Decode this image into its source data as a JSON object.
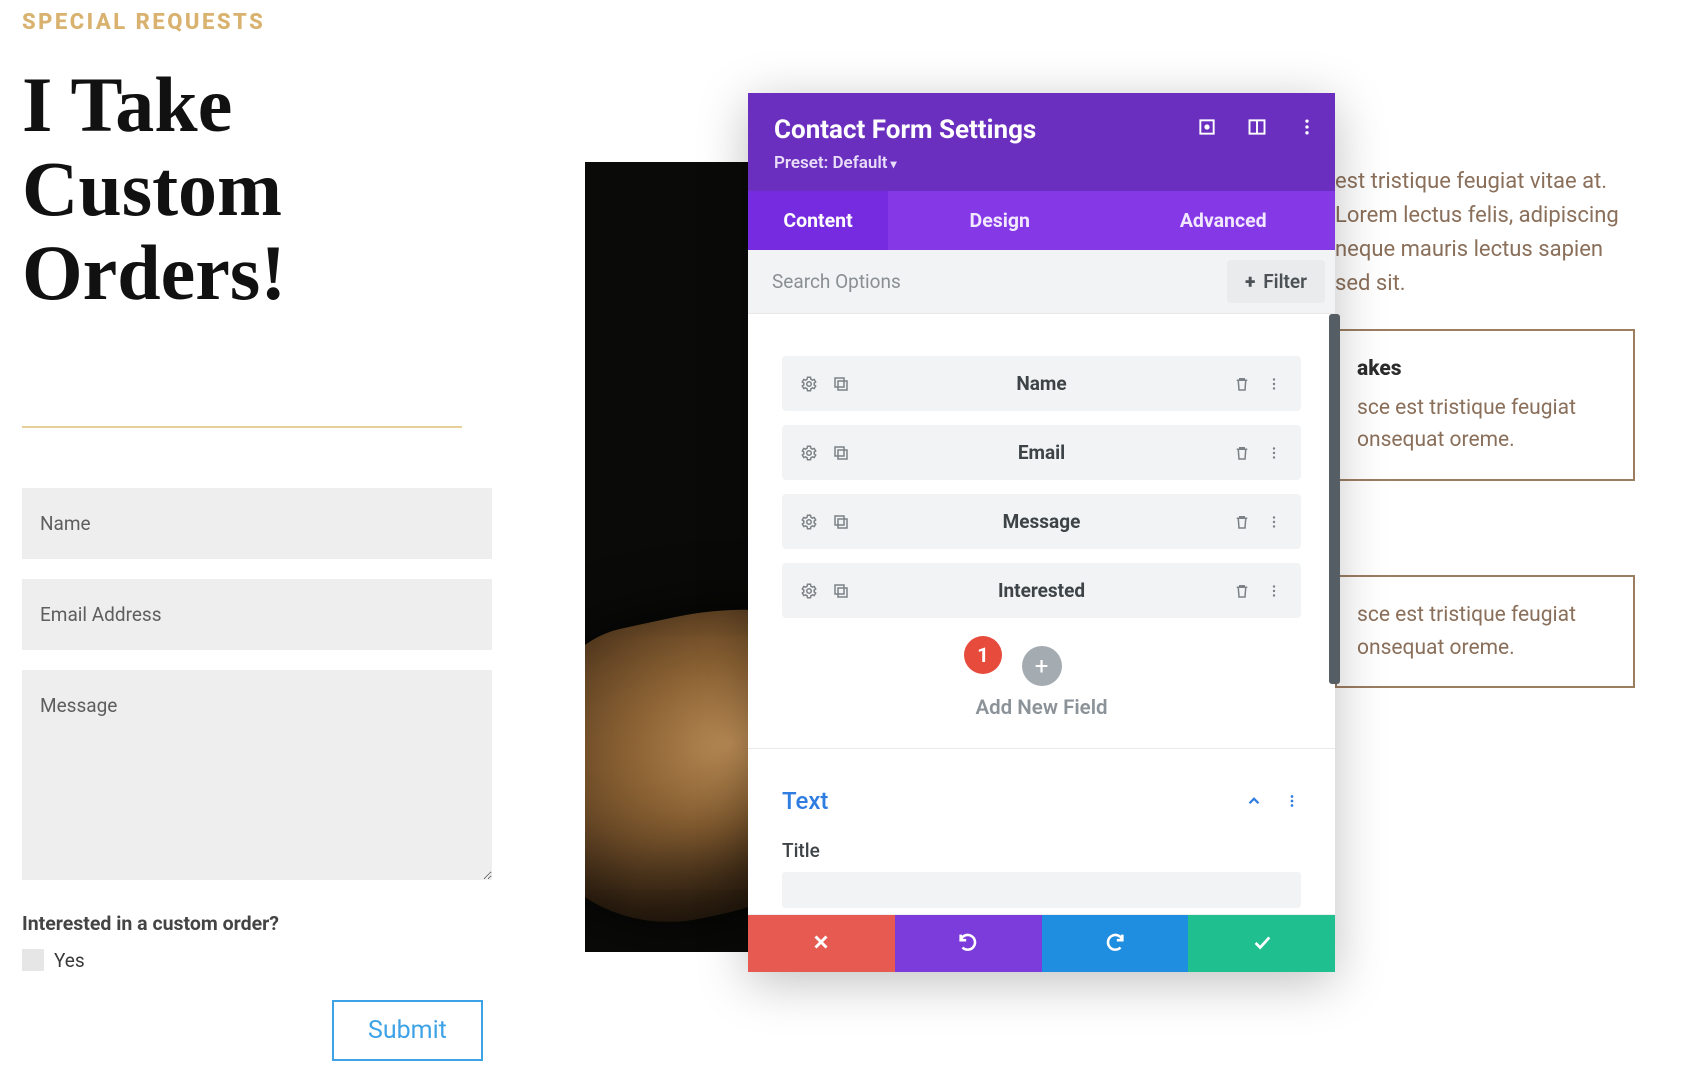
{
  "page": {
    "eyebrow": "SPECIAL REQUESTS",
    "headline": "I Take Custom Orders!"
  },
  "form": {
    "name_placeholder": "Name",
    "email_placeholder": "Email Address",
    "message_placeholder": "Message",
    "interest_label": "Interested in a custom order?",
    "checkbox_label": "Yes",
    "submit_label": "Submit"
  },
  "right": {
    "intro": "est tristique feugiat vitae at. Lorem lectus felis, adipiscing neque mauris lectus sapien sed sit.",
    "card1_title": "akes",
    "card1_body": "sce est tristique feugiat onsequat oreme.",
    "card2_body": "sce est tristique feugiat onsequat oreme."
  },
  "modal": {
    "title": "Contact Form Settings",
    "preset_label": "Preset: Default",
    "tabs": [
      "Content",
      "Design",
      "Advanced"
    ],
    "active_tab_index": 0,
    "search_placeholder": "Search Options",
    "filter_label": "Filter",
    "fields": [
      {
        "name": "Name"
      },
      {
        "name": "Email"
      },
      {
        "name": "Message"
      },
      {
        "name": "Interested"
      }
    ],
    "annotation_badge": "1",
    "add_new_label": "Add New Field",
    "text_section_title": "Text",
    "title_label": "Title"
  },
  "colors": {
    "accent_purple": "#6b2fbf",
    "tab_purple": "#8438e6",
    "gold": "#d8b26e",
    "link_blue": "#2f7de1"
  }
}
